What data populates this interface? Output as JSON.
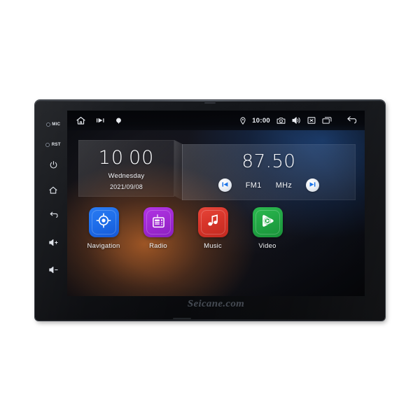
{
  "device": {
    "brand_text": "Seicane.com",
    "hardware_buttons": [
      {
        "id": "mic",
        "label": "MIC",
        "icon": "mic-indicator-dot",
        "has_dot": true
      },
      {
        "id": "rst",
        "label": "RST",
        "icon": "reset-indicator-dot",
        "has_dot": true
      },
      {
        "id": "power",
        "label": "",
        "icon": "power-icon",
        "has_dot": false
      },
      {
        "id": "home",
        "label": "",
        "icon": "home-icon",
        "has_dot": false
      },
      {
        "id": "back",
        "label": "",
        "icon": "back-arrow-icon",
        "has_dot": false
      },
      {
        "id": "volume-up",
        "label": "",
        "icon": "volume-up-icon",
        "has_dot": false
      },
      {
        "id": "volume-down",
        "label": "",
        "icon": "volume-down-icon",
        "has_dot": false
      }
    ]
  },
  "statusbar": {
    "home_icon": "home-icon",
    "play_icon": "play-badge-icon",
    "record_icon": "record-badge-icon",
    "gps_icon": "location-pin-icon",
    "clock": "10:00",
    "camera_icon": "camera-icon",
    "volume_icon": "speaker-icon",
    "close_icon": "close-box-icon",
    "recents_icon": "recent-apps-icon",
    "back_icon": "back-arrow-icon"
  },
  "clock_widget": {
    "hours": "10",
    "minutes": "00",
    "weekday": "Wednesday",
    "date": "2021/09/08"
  },
  "radio_widget": {
    "frequency": "87.50",
    "band": "FM1",
    "unit": "MHz",
    "prev_icon": "skip-previous-icon",
    "next_icon": "skip-next-icon",
    "button_accent": "#1a73e8"
  },
  "apps": [
    {
      "id": "navigation",
      "label": "Navigation",
      "icon": "navigation-target-icon",
      "color": "#1f6feb",
      "color2": "#1558d6"
    },
    {
      "id": "radio",
      "label": "Radio",
      "icon": "radio-receiver-icon",
      "color": "#a22bd4",
      "color2": "#8a1ec0"
    },
    {
      "id": "music",
      "label": "Music",
      "icon": "music-note-icon",
      "color": "#d8352a",
      "color2": "#c12a20"
    },
    {
      "id": "video",
      "label": "Video",
      "icon": "video-play-icon",
      "color": "#22a745",
      "color2": "#199239"
    }
  ]
}
